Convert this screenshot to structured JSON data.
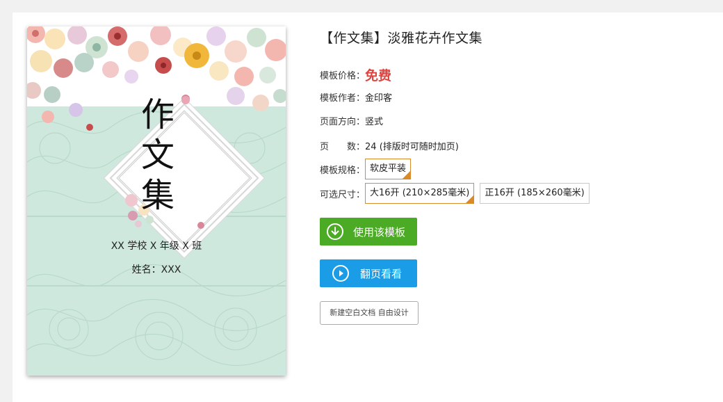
{
  "cover": {
    "title_chars": [
      "作",
      "文",
      "集"
    ],
    "school_line": "XX 学校 X 年级 X 班",
    "name_line": "姓名：XXX"
  },
  "detail": {
    "title": "【作文集】淡雅花卉作文集",
    "price_label": "模板价格：",
    "price_value": "免费",
    "author_label": "模板作者：",
    "author_value": "金印客",
    "direction_label": "页面方向：",
    "direction_value": "竖式",
    "pages_label": "页　　数：",
    "pages_value": "24 (排版时可随时加页)",
    "spec_label": "模板规格：",
    "spec_options": [
      "软皮平装"
    ],
    "size_label": "可选尺寸：",
    "size_options": [
      "大16开 (210×285毫米)",
      "正16开 (185×260毫米)"
    ]
  },
  "actions": {
    "use_template": "使用该模板",
    "flip_preview": "翻页看看",
    "blank_doc": "新建空白文档 自由设计"
  },
  "colors": {
    "price": "#e0443f",
    "green_button": "#4cab24",
    "blue_button": "#1a9de6",
    "selected_border": "#d98a2b",
    "cover_bg": "#cfe8dd"
  },
  "icons": {
    "use_template": "download-circle-icon",
    "flip_preview": "play-circle-icon",
    "selected_marker": "check-corner-icon"
  }
}
